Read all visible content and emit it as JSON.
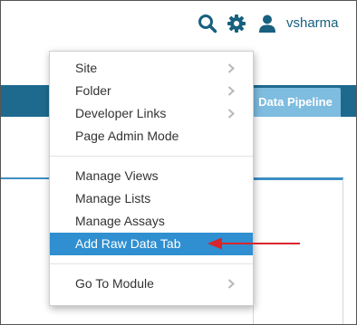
{
  "header": {
    "username": "vsharma",
    "icons": [
      "search-icon",
      "gear-icon",
      "user-icon"
    ]
  },
  "nav": {
    "active_tab_label": "Data Pipeline"
  },
  "menu": {
    "items": [
      {
        "label": "Site",
        "has_submenu": true
      },
      {
        "label": "Folder",
        "has_submenu": true
      },
      {
        "label": "Developer Links",
        "has_submenu": true
      },
      {
        "label": "Page Admin Mode",
        "has_submenu": false
      },
      {
        "label": "Manage Views",
        "has_submenu": false
      },
      {
        "label": "Manage Lists",
        "has_submenu": false
      },
      {
        "label": "Manage Assays",
        "has_submenu": false
      },
      {
        "label": "Add Raw Data Tab",
        "has_submenu": false,
        "highlighted": true
      },
      {
        "label": "Go To Module",
        "has_submenu": true
      }
    ]
  },
  "colors": {
    "brand_blue": "#1e6a8f",
    "highlight": "#2f8fd0",
    "annotation_arrow": "#d9252b",
    "header_icon": "#17607f"
  }
}
